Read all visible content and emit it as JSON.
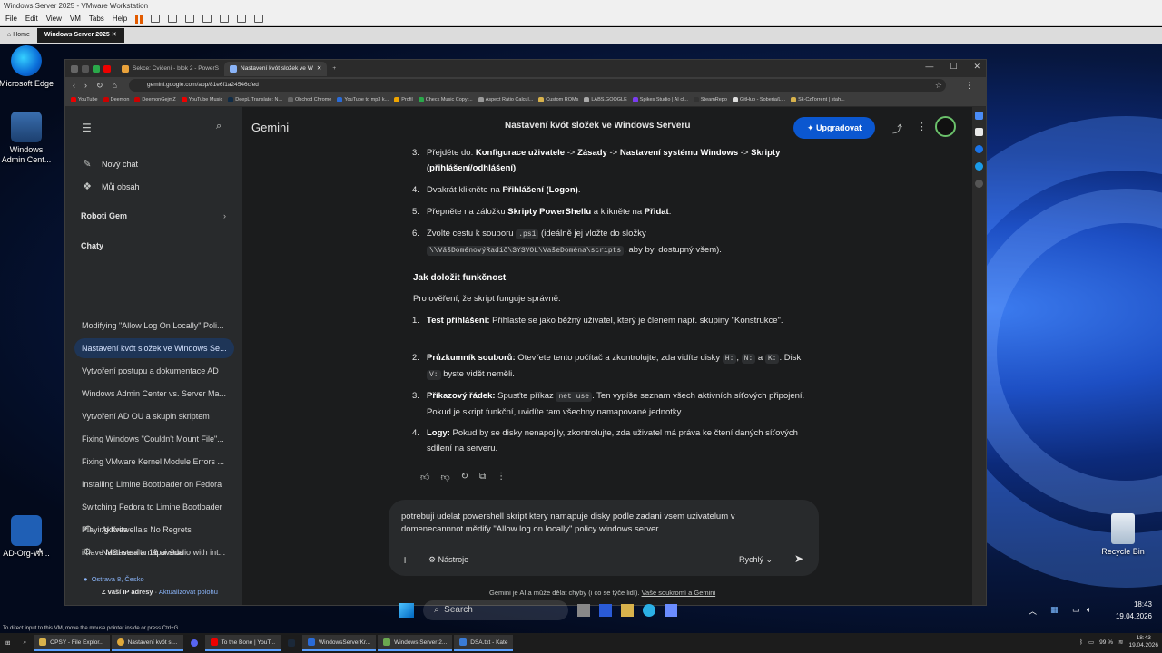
{
  "vmware": {
    "title": "Windows Server 2025 - VMware Workstation",
    "menu": [
      "File",
      "Edit",
      "View",
      "VM",
      "Tabs",
      "Help"
    ],
    "tabs": [
      {
        "label": "Home"
      },
      {
        "label": "Windows Server 2025"
      }
    ],
    "status": "To direct input to this VM, move the mouse pointer inside or press Ctrl+G."
  },
  "desktop": {
    "icons": [
      "Microsoft Edge",
      "Windows Admin Cent...",
      "AD-Org-Wi...",
      "A",
      "Recycle Bin"
    ]
  },
  "browser": {
    "tabs": [
      {
        "label": "Sekce: Cvičení - blok 2 - PowerS",
        "active": false
      },
      {
        "label": "Nastavení kvót složek ve W",
        "active": true
      }
    ],
    "new_tab": "+",
    "url": "gemini.google.com/app/81e6f1a24546cfed",
    "bookmarks": [
      "YouTube",
      "Deemon",
      "DeemonGejmZ",
      "YouTube Music",
      "DeepL Translate: N...",
      "Obchod Chrome",
      "YouTube to mp3 k...",
      "Profil",
      "Check Music Copyr...",
      "Aspect Ratio Calcul...",
      "Custom ROMs",
      "LABS.GOOGLE",
      "Spikes Studio | AI cl...",
      "SteamRepo",
      "GitHub - Soberia/L...",
      "Sk-CzTorrent | stah..."
    ]
  },
  "gemini": {
    "brand": "Gemini",
    "chat_title": "Nastavení kvót složek ve Windows Serveru",
    "upgrade": "Upgradovat",
    "new_chat": "Nový chat",
    "my_content": "Můj obsah",
    "gems": "Roboti Gem",
    "chats_heading": "Chaty",
    "chats": [
      "Modifying \"Allow Log On Locally\" Poli...",
      "Nastavení kvót složek ve Windows Se...",
      "Vytvoření postupu a dokumentace AD",
      "Windows Admin Center vs. Server Ma...",
      "Vytvoření AD OU a skupin skriptem",
      "Fixing Windows \"Couldn't Mount File\"...",
      "Fixing VMware Kernel Module Errors ...",
      "Installing Limine Bootloader on Fedora",
      "Switching Fedora to Limine Bootloader",
      "Playing Krewella's No Regrets",
      "i have MSI stealth 16 ai studio with int..."
    ],
    "activity": "Aktivita",
    "settings": "Nastavení a nápověda",
    "location": "Ostrava 8, Česko",
    "location_source": "Z vaší IP adresy",
    "update_location": "Aktualizovat polohu",
    "steps": [
      {
        "n": "3.",
        "parts": [
          "Přejděte do: ",
          "Konfigurace uživatele",
          " -> ",
          "Zásady",
          " -> ",
          "Nastavení systému Windows",
          " -> ",
          "Skripty (přihlášení/odhlášení)",
          "."
        ]
      },
      {
        "n": "4.",
        "a": "Dvakrát klikněte na ",
        "b": "Přihlášení (Logon)",
        "c": "."
      },
      {
        "n": "5.",
        "a": "Přepněte na záložku ",
        "b": "Skripty PowerShellu",
        "c": " a klikněte na ",
        "d": "Přidat",
        "e": "."
      },
      {
        "n": "6.",
        "a": "Zvolte cestu k souboru ",
        "code1": ".ps1",
        "b": " (ideálně jej vložte do složky ",
        "code2": "\\\\VášDoménovýRadič\\SYSVOL\\VašeDoména\\scripts",
        "c": ", aby byl dostupný všem)."
      }
    ],
    "verify_heading": "Jak doložit funkčnost",
    "verify_intro": "Pro ověření, že skript funguje správně:",
    "verify": [
      {
        "n": "1.",
        "title": "Test přihlášení:",
        "text": " Přihlaste se jako běžný uživatel, který je členem např. skupiny \"Konstrukce\"."
      },
      {
        "n": "2.",
        "title": "Průzkumník souborů:",
        "a": " Otevřete tento počítač a zkontrolujte, zda vidíte disky ",
        "c1": "H:",
        "b": ", ",
        "c2": "N:",
        "c": " a ",
        "c3": "K:",
        "d": ". Disk ",
        "c4": "V:",
        "e": " byste vidět neměli."
      },
      {
        "n": "3.",
        "title": "Příkazový řádek:",
        "a": " Spusťte příkaz ",
        "c1": "net use",
        "b": ". Ten vypíše seznam všech aktivních síťových připojení. Pokud je skript funkční, uvidíte tam všechny namapované jednotky."
      },
      {
        "n": "4.",
        "title": "Logy:",
        "text": " Pokud by se disky nenapojily, zkontrolujte, zda uživatel má práva ke čtení daných síťových sdílení na serveru."
      }
    ],
    "prompt": "potrebuji udelat powershell skript ktery namapuje disky podle zadani vsem uzivatelum v domenecannnot mědify \"Allow log on locally\" policy windows server",
    "tools": "Nástroje",
    "mode": "Rychlý",
    "disclaimer": "Gemini je AI a může dělat chyby (i co se týče lidí).",
    "privacy": "Vaše soukromí a Gemini"
  },
  "guest": {
    "search": "Search",
    "time": "18:43",
    "date": "19.04.2026"
  },
  "host_taskbar": {
    "items": [
      "OPSY - File Explor...",
      "Nastavení kvót sl...",
      "To the Bone | YouT...",
      "WindowsServerKr...",
      "Windows Server 2...",
      "DSA.txt - Kate"
    ],
    "battery": "99 %",
    "time": "18:43",
    "date": "19.04.2026"
  },
  "colors": {
    "accent": "#0b57d0",
    "active_chat": "#1e3557",
    "sidebar": "#282a2c",
    "main": "#1b1c1d"
  }
}
